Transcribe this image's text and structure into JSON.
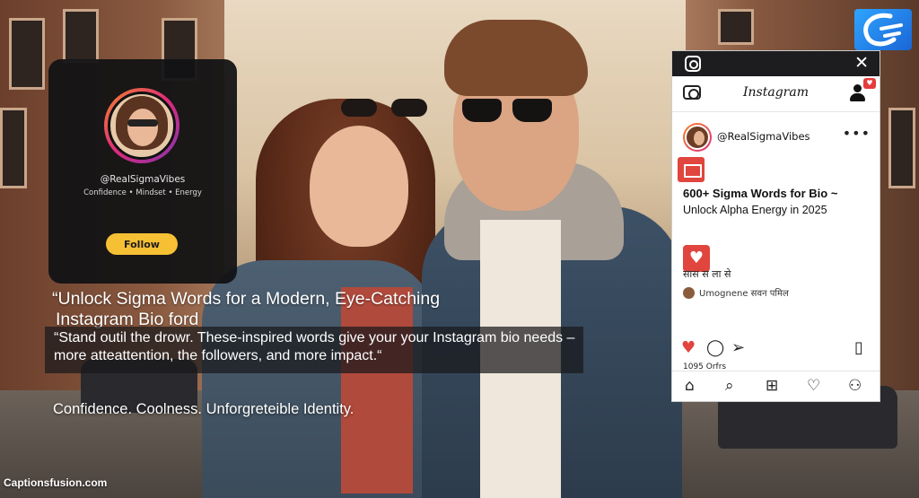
{
  "brand": {
    "site": "Captionsfusion.com",
    "logo_letters": "CF"
  },
  "profile_card": {
    "handle": "@RealSigmaVibes",
    "tagline": "Confidence • Mindset • Energy",
    "follow_label": "Follow"
  },
  "headline": {
    "line1": "“Unlock Sigma Words for a Modern, Eye-Catching",
    "line2": "Instagram Bio ford",
    "quote": "“Stand outil the drowr. These-inspired words give your your Instagram bio needs – more atteattention, the followers, and more impact.“",
    "slogan": "Confidence. Coolness. Unforgreteible Identity."
  },
  "phone": {
    "app_title": "Instagram",
    "notif_icon": "heart-icon",
    "post_handle": "@RealSigmaVibes",
    "more_label": "•••",
    "post_title": "600+ Sigma Words for Bio  ~",
    "post_subtitle": "Unlock Alpha Energy in 2025",
    "hindi_text": "सास स ला से",
    "comment_text": "Umognene सवन पमिल",
    "likes_text": "1095 Orfrs",
    "colors": {
      "accent_red": "#e0453e",
      "follow_yellow": "#f6c034",
      "logo_blue": "#1a66d6"
    }
  }
}
